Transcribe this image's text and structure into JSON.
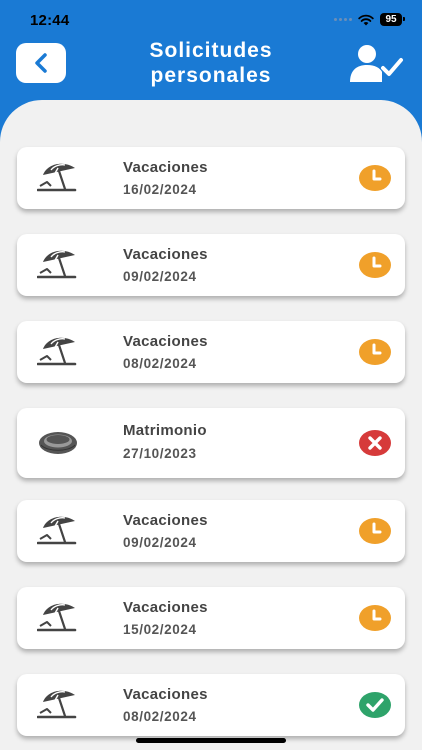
{
  "status_bar": {
    "time": "12:44",
    "battery": "95"
  },
  "header": {
    "title_line1": "Solicitudes",
    "title_line2": "personales"
  },
  "colors": {
    "brand_blue": "#1a7ad4",
    "pending_orange": "#f0a02a",
    "rejected_red": "#d63a3a",
    "approved_green": "#2ea36a"
  },
  "requests": [
    {
      "type": "Vacaciones",
      "date": "16/02/2024",
      "icon": "beach-umbrella-icon",
      "status": "pending"
    },
    {
      "type": "Vacaciones",
      "date": "09/02/2024",
      "icon": "beach-umbrella-icon",
      "status": "pending"
    },
    {
      "type": "Vacaciones",
      "date": "08/02/2024",
      "icon": "beach-umbrella-icon",
      "status": "pending"
    },
    {
      "type": "Matrimonio",
      "date": "27/10/2023",
      "icon": "wedding-ring-icon",
      "status": "rejected"
    },
    {
      "type": "Vacaciones",
      "date": "09/02/2024",
      "icon": "beach-umbrella-icon",
      "status": "pending"
    },
    {
      "type": "Vacaciones",
      "date": "15/02/2024",
      "icon": "beach-umbrella-icon",
      "status": "pending"
    },
    {
      "type": "Vacaciones",
      "date": "08/02/2024",
      "icon": "beach-umbrella-icon",
      "status": "approved"
    }
  ]
}
